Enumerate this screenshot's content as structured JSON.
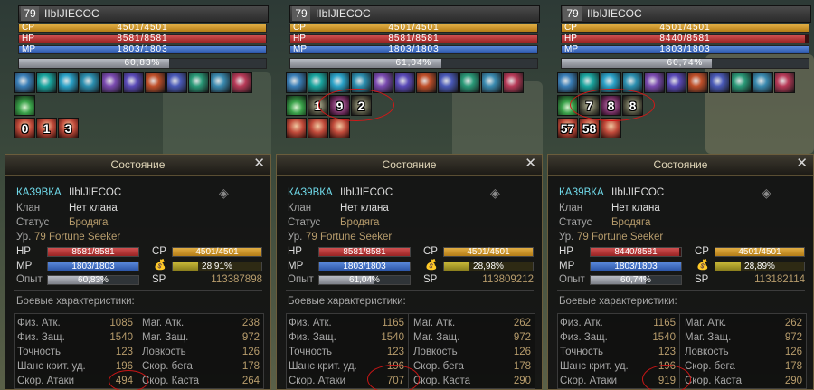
{
  "panels": [
    {
      "level": "79",
      "nickname": "IIbIJIECOC",
      "bars": {
        "cp": {
          "label": "CP",
          "value": "4501/4501",
          "fraction": 1.0
        },
        "hp": {
          "label": "HP",
          "value": "8581/8581",
          "fraction": 1.0
        },
        "mp": {
          "label": "MP",
          "value": "1803/1803",
          "fraction": 1.0
        },
        "exp": {
          "value": "60,83%",
          "fraction": 0.6083
        }
      },
      "counters": [
        "",
        "",
        ""
      ],
      "bottom_counters": [
        "0",
        "1",
        "3"
      ],
      "char": {
        "title": "Состояние",
        "close": "✕",
        "name": "КАЗ9ВКА",
        "nick": "IIbIJIECOC",
        "clan_label": "Клан",
        "clan_value": "Нет клана",
        "status_label": "Статус",
        "status_value": "Бродяга",
        "class_label": "Ур.",
        "class_value": "79 Fortune Seeker",
        "hp_label": "HP",
        "hp_value": "8581/8581",
        "hp_fraction": 1.0,
        "mp_label": "MP",
        "mp_value": "1803/1803",
        "mp_fraction": 1.0,
        "cp_label": "CP",
        "cp_value": "4501/4501",
        "cp_fraction": 1.0,
        "weight_value": "28,91%",
        "weight_fraction": 0.2891,
        "exp_label": "Опыт",
        "exp_value": "60,83%",
        "exp_fraction": 0.6083,
        "sp_label": "SP",
        "sp_value": "113387898",
        "combat_title": "Боевые характеристики:",
        "left_stats": [
          {
            "label": "Физ. Атк.",
            "value": "1085"
          },
          {
            "label": "Физ. Защ.",
            "value": "1540"
          },
          {
            "label": "Точность",
            "value": "123"
          },
          {
            "label": "Шанс крит. уд.",
            "value": "196"
          },
          {
            "label": "Скор. Атаки",
            "value": "494"
          }
        ],
        "right_stats": [
          {
            "label": "Маг. Атк.",
            "value": "238"
          },
          {
            "label": "Маг. Защ.",
            "value": "972"
          },
          {
            "label": "Ловкость",
            "value": "126"
          },
          {
            "label": "Скор. бега",
            "value": "178"
          },
          {
            "label": "Скор. Каста",
            "value": "264"
          }
        ]
      }
    },
    {
      "level": "79",
      "nickname": "IIbIJIECOC",
      "bars": {
        "cp": {
          "label": "CP",
          "value": "4501/4501",
          "fraction": 1.0
        },
        "hp": {
          "label": "HP",
          "value": "8581/8581",
          "fraction": 1.0
        },
        "mp": {
          "label": "MP",
          "value": "1803/1803",
          "fraction": 1.0
        },
        "exp": {
          "value": "61,04%",
          "fraction": 0.6104
        }
      },
      "counters": [
        "1",
        "9",
        "2"
      ],
      "bottom_counters": [
        "",
        "",
        ""
      ],
      "char": {
        "title": "Состояние",
        "close": "✕",
        "name": "КАЗ9ВКА",
        "nick": "IIbIJIECOC",
        "clan_label": "Клан",
        "clan_value": "Нет клана",
        "status_label": "Статус",
        "status_value": "Бродяга",
        "class_label": "Ур.",
        "class_value": "79 Fortune Seeker",
        "hp_label": "HP",
        "hp_value": "8581/8581",
        "hp_fraction": 1.0,
        "mp_label": "MP",
        "mp_value": "1803/1803",
        "mp_fraction": 1.0,
        "cp_label": "CP",
        "cp_value": "4501/4501",
        "cp_fraction": 1.0,
        "weight_value": "28,98%",
        "weight_fraction": 0.2898,
        "exp_label": "Опыт",
        "exp_value": "61,04%",
        "exp_fraction": 0.6104,
        "sp_label": "SP",
        "sp_value": "113809212",
        "combat_title": "Боевые характеристики:",
        "left_stats": [
          {
            "label": "Физ. Атк.",
            "value": "1165"
          },
          {
            "label": "Физ. Защ.",
            "value": "1540"
          },
          {
            "label": "Точность",
            "value": "123"
          },
          {
            "label": "Шанс крит. уд.",
            "value": "196"
          },
          {
            "label": "Скор. Атаки",
            "value": "707"
          }
        ],
        "right_stats": [
          {
            "label": "Маг. Атк.",
            "value": "262"
          },
          {
            "label": "Маг. Защ.",
            "value": "972"
          },
          {
            "label": "Ловкость",
            "value": "126"
          },
          {
            "label": "Скор. бега",
            "value": "178"
          },
          {
            "label": "Скор. Каста",
            "value": "290"
          }
        ]
      }
    },
    {
      "level": "79",
      "nickname": "IIbIJIECOC",
      "bars": {
        "cp": {
          "label": "CP",
          "value": "4501/4501",
          "fraction": 1.0
        },
        "hp": {
          "label": "HP",
          "value": "8440/8581",
          "fraction": 0.9836
        },
        "mp": {
          "label": "MP",
          "value": "1803/1803",
          "fraction": 1.0
        },
        "exp": {
          "value": "60,74%",
          "fraction": 0.6074
        }
      },
      "counters": [
        "7",
        "8",
        "8"
      ],
      "bottom_counters": [
        "57",
        "58",
        ""
      ],
      "char": {
        "title": "Состояние",
        "close": "✕",
        "name": "КАЗ9ВКА",
        "nick": "IIbIJIECOC",
        "clan_label": "Клан",
        "clan_value": "Нет клана",
        "status_label": "Статус",
        "status_value": "Бродяга",
        "class_label": "Ур.",
        "class_value": "79 Fortune Seeker",
        "hp_label": "HP",
        "hp_value": "8440/8581",
        "hp_fraction": 0.9836,
        "mp_label": "MP",
        "mp_value": "1803/1803",
        "mp_fraction": 1.0,
        "cp_label": "CP",
        "cp_value": "4501/4501",
        "cp_fraction": 1.0,
        "weight_value": "28,89%",
        "weight_fraction": 0.2889,
        "exp_label": "Опыт",
        "exp_value": "60,74%",
        "exp_fraction": 0.6074,
        "sp_label": "SP",
        "sp_value": "113182114",
        "combat_title": "Боевые характеристики:",
        "left_stats": [
          {
            "label": "Физ. Атк.",
            "value": "1165"
          },
          {
            "label": "Физ. Защ.",
            "value": "1540"
          },
          {
            "label": "Точность",
            "value": "123"
          },
          {
            "label": "Шанс крит. уд.",
            "value": "196"
          },
          {
            "label": "Скор. Атаки",
            "value": "919"
          }
        ],
        "right_stats": [
          {
            "label": "Маг. Атк.",
            "value": "262"
          },
          {
            "label": "Маг. Защ.",
            "value": "972"
          },
          {
            "label": "Ловкость",
            "value": "126"
          },
          {
            "label": "Скор. бега",
            "value": "178"
          },
          {
            "label": "Скор. Каста",
            "value": "290"
          }
        ]
      }
    }
  ],
  "buff_icon_colors": [
    "#3a7fb8",
    "#1aa6a0",
    "#2aa2c8",
    "#2b8fb0",
    "#7a4ab0",
    "#5a4ab8",
    "#c0502a",
    "#4a5ab8",
    "#2a9a78",
    "#3a8ab0",
    "#b83a58"
  ],
  "accent_red": "#d21818"
}
